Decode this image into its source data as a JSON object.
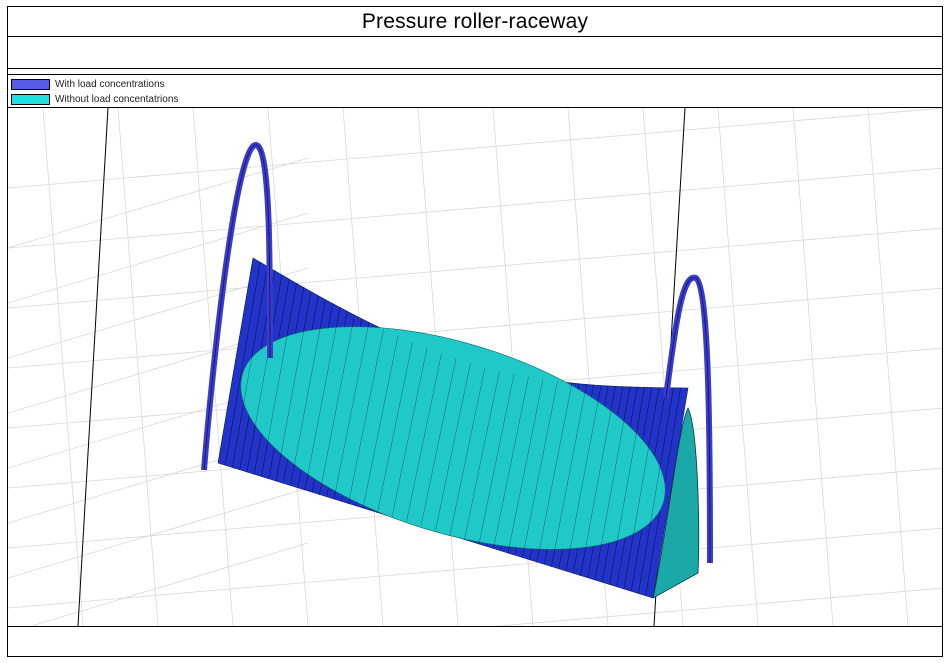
{
  "window": {
    "title": "Pressure roller-raceway"
  },
  "legend": {
    "items": [
      {
        "label": "With load concentrations",
        "color": "#5a5ae8"
      },
      {
        "label": "Without load concentatrions",
        "color": "#1fe0e0"
      }
    ]
  },
  "chart_data": {
    "type": "surface",
    "title": "Pressure roller-raceway",
    "series": [
      {
        "name": "With load concentrations",
        "color": "#2233cc"
      },
      {
        "name": "Without load concentatrions",
        "color": "#20c8c8"
      }
    ],
    "grid": true,
    "legend_position": "top-left",
    "axis_labels": {
      "x": "",
      "y": "",
      "z": ""
    }
  }
}
